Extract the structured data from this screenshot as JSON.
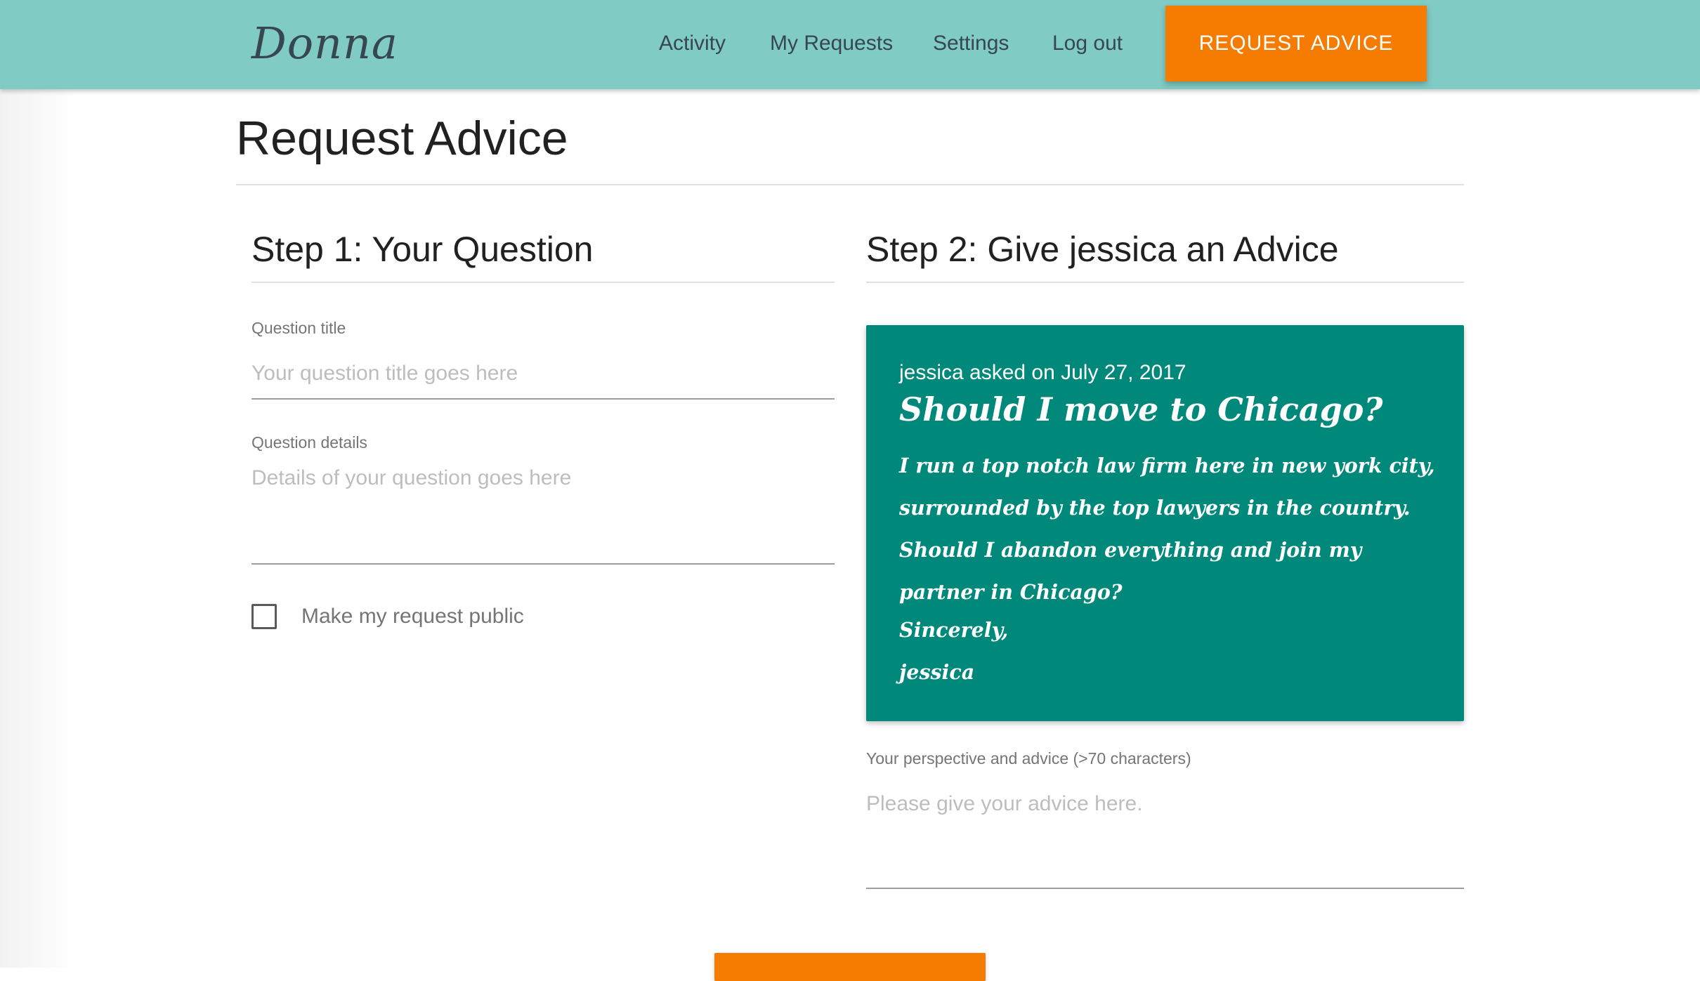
{
  "brand": "Donna",
  "nav": {
    "links": [
      "Activity",
      "My Requests",
      "Settings",
      "Log out"
    ],
    "cta_label": "REQUEST ADVICE"
  },
  "page": {
    "title": "Request Advice"
  },
  "step1": {
    "title": "Step 1: Your Question",
    "question_title_label": "Question title",
    "question_title_placeholder": "Your question title goes here",
    "question_details_label": "Question details",
    "question_details_placeholder": "Details of your question goes here",
    "public_checkbox_label": "Make my request public",
    "public_checkbox_checked": false
  },
  "step2": {
    "title": "Step 2: Give jessica an Advice",
    "card": {
      "meta": "jessica asked on July 27, 2017",
      "question_title": "Should I move to Chicago?",
      "question_body": "I run a top notch law firm here in new york city, surrounded by the top lawyers in the country. Should I abandon everything and join my partner in Chicago?",
      "signoff_line1": "Sincerely,",
      "signoff_line2": "jessica",
      "background_color": "#00897b"
    },
    "advice_label": "Your perspective and advice (>70 characters)",
    "advice_placeholder": "Please give your advice here."
  },
  "colors": {
    "navbar": "#80cbc4",
    "accent": "#f57c00"
  }
}
